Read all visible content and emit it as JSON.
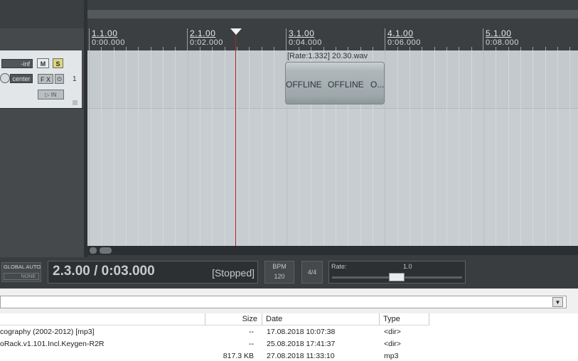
{
  "ruler": {
    "markers": [
      {
        "bar": "1.1.00",
        "time": "0:00.000"
      },
      {
        "bar": "2.1.00",
        "time": "0:02.000"
      },
      {
        "bar": "3.1.00",
        "time": "0:04.000"
      },
      {
        "bar": "4.1.00",
        "time": "0:06.000"
      },
      {
        "bar": "5.1.00",
        "time": "0:08.000"
      }
    ]
  },
  "track": {
    "volume": "-inf",
    "mute_label": "M",
    "solo_label": "S",
    "pan": "center",
    "fx_label": "F X",
    "power_label": "⏻",
    "input_label": "▷ IN",
    "number": "1"
  },
  "item": {
    "name": "[Rate:1.332] 20.30.wav",
    "offline_labels": [
      "OFFLINE",
      "OFFLINE",
      "O..."
    ]
  },
  "transport": {
    "global_auto": "GLOBAL AUTO",
    "auto_mode": "NONE",
    "position": "2.3.00 / 0:03.000",
    "status": "[Stopped]",
    "bpm_label": "BPM",
    "bpm_value": "120",
    "time_signature": "4/4",
    "rate_label": "Rate:",
    "rate_value": "1.0"
  },
  "browser": {
    "columns": {
      "name": "",
      "size": "Size",
      "date": "Date",
      "type": "Type"
    },
    "rows": [
      {
        "name": "cography (2002-2012) [mp3]",
        "size": "--",
        "date": "17.08.2018 10:07:38",
        "type": "<dir>"
      },
      {
        "name": "oRack.v1.101.Incl.Keygen-R2R",
        "size": "--",
        "date": "25.08.2018 17:41:37",
        "type": "<dir>"
      },
      {
        "name": "",
        "size": "817.3 KB",
        "date": "27.08.2018 11:33:10",
        "type": "mp3"
      }
    ]
  },
  "colors": {
    "playhead": "#a8282a",
    "solo": "#dcd77a",
    "background": "#3a3d3f",
    "arrange": "#c7cdd0"
  }
}
